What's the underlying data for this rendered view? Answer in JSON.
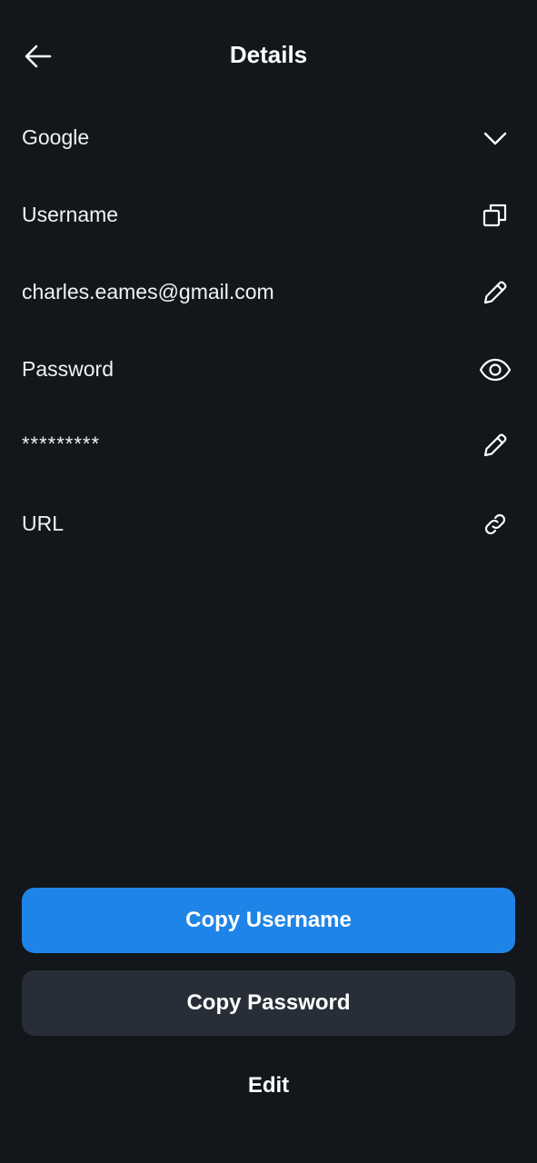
{
  "header": {
    "title": "Details",
    "back_icon": "arrow-left-icon"
  },
  "rows": [
    {
      "label": "Google",
      "icon": "chevron-down-icon"
    },
    {
      "label": "Username",
      "icon": "copy-icon"
    },
    {
      "label": "charles.eames@gmail.com",
      "icon": "pencil-icon"
    },
    {
      "label": "Password",
      "icon": "eye-icon"
    },
    {
      "label": "*********",
      "icon": "pencil-icon"
    },
    {
      "label": "URL",
      "icon": "link-icon"
    }
  ],
  "actions": {
    "copy_username": "Copy Username",
    "copy_password": "Copy Password",
    "edit": "Edit"
  },
  "colors": {
    "background": "#13171b",
    "primary": "#1f84e8",
    "secondary": "#282e37",
    "text": "#ffffff"
  }
}
